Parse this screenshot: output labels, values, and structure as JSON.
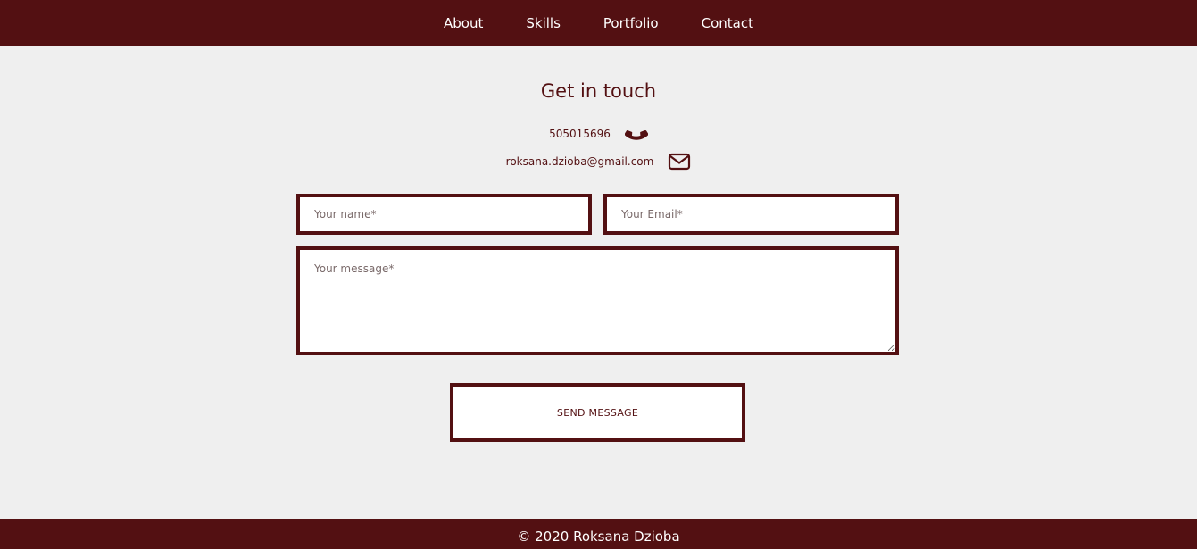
{
  "nav": {
    "items": [
      {
        "label": "About"
      },
      {
        "label": "Skills"
      },
      {
        "label": "Portfolio"
      },
      {
        "label": "Contact"
      }
    ]
  },
  "contact": {
    "heading": "Get in touch",
    "phone": "505015696",
    "phone_icon": "phone-icon",
    "email": "roksana.dzioba@gmail.com",
    "email_icon": "envelope-icon"
  },
  "form": {
    "name_placeholder": "Your name*",
    "email_placeholder": "Your Email*",
    "message_placeholder": "Your message*",
    "send_label": "SEND MESSAGE"
  },
  "footer": {
    "text": "© 2020 Roksana Dzioba"
  },
  "colors": {
    "brand": "#531012",
    "background": "#efefef"
  }
}
